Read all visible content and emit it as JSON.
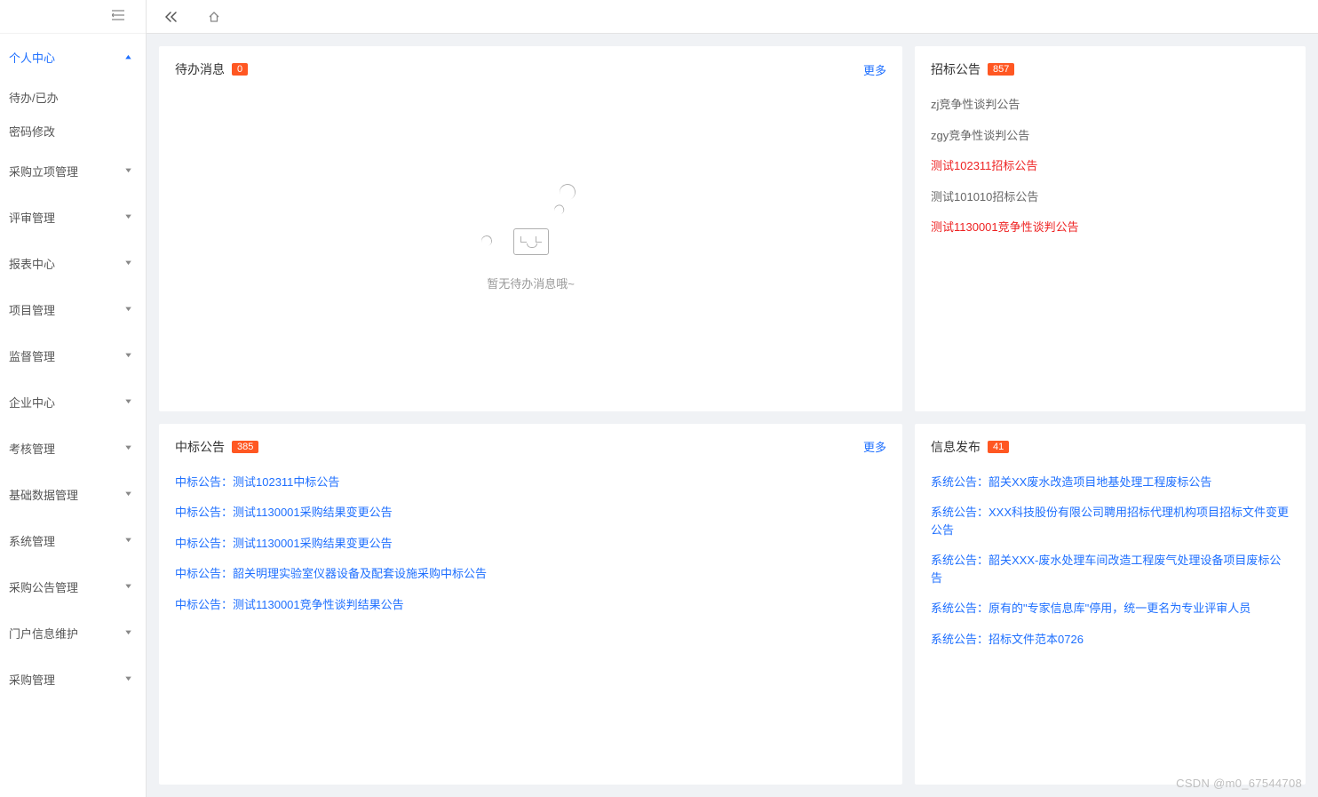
{
  "sidebar": {
    "items": [
      {
        "label": "个人中心",
        "expandable": true,
        "active": true,
        "children": [
          {
            "label": "待办/已办"
          },
          {
            "label": "密码修改"
          }
        ]
      },
      {
        "label": "采购立项管理",
        "expandable": true
      },
      {
        "label": "评审管理",
        "expandable": true
      },
      {
        "label": "报表中心",
        "expandable": true
      },
      {
        "label": "项目管理",
        "expandable": true
      },
      {
        "label": "监督管理",
        "expandable": true
      },
      {
        "label": "企业中心",
        "expandable": true
      },
      {
        "label": "考核管理",
        "expandable": true
      },
      {
        "label": "基础数据管理",
        "expandable": true
      },
      {
        "label": "系统管理",
        "expandable": true
      },
      {
        "label": "采购公告管理",
        "expandable": true
      },
      {
        "label": "门户信息维护",
        "expandable": true
      },
      {
        "label": "采购管理",
        "expandable": true
      }
    ]
  },
  "cards": {
    "todo": {
      "title": "待办消息",
      "badge": "0",
      "more": "更多",
      "empty_text": "暂无待办消息哦~"
    },
    "zhaobiao": {
      "title": "招标公告",
      "badge": "857",
      "items": [
        {
          "text": "zj竞争性谈判公告",
          "style": "muted"
        },
        {
          "text": "zgy竞争性谈判公告",
          "style": "muted"
        },
        {
          "text": "测试102311招标公告",
          "style": "red"
        },
        {
          "text": "测试101010招标公告",
          "style": "muted"
        },
        {
          "text": "测试1130001竞争性谈判公告",
          "style": "red"
        }
      ]
    },
    "zhongbiao": {
      "title": "中标公告",
      "badge": "385",
      "more": "更多",
      "items": [
        {
          "text": "中标公告：测试102311中标公告",
          "style": "link"
        },
        {
          "text": "中标公告：测试1130001采购结果变更公告",
          "style": "link"
        },
        {
          "text": "中标公告：测试1130001采购结果变更公告",
          "style": "link"
        },
        {
          "text": "中标公告：韶关明理实验室仪器设备及配套设施采购中标公告",
          "style": "link"
        },
        {
          "text": "中标公告：测试1130001竞争性谈判结果公告",
          "style": "link"
        }
      ]
    },
    "xinxi": {
      "title": "信息发布",
      "badge": "41",
      "items": [
        {
          "text": "系统公告：韶关XX废水改造项目地基处理工程废标公告",
          "style": "link"
        },
        {
          "text": "系统公告：XXX科技股份有限公司聘用招标代理机构项目招标文件变更公告",
          "style": "link"
        },
        {
          "text": "系统公告：韶关XXX-废水处理车间改造工程废气处理设备项目废标公告",
          "style": "link"
        },
        {
          "text": "系统公告：原有的\"专家信息库\"停用，统一更名为专业评审人员",
          "style": "link"
        },
        {
          "text": "系统公告：招标文件范本0726",
          "style": "link"
        }
      ]
    }
  },
  "watermark": "CSDN @m0_67544708"
}
